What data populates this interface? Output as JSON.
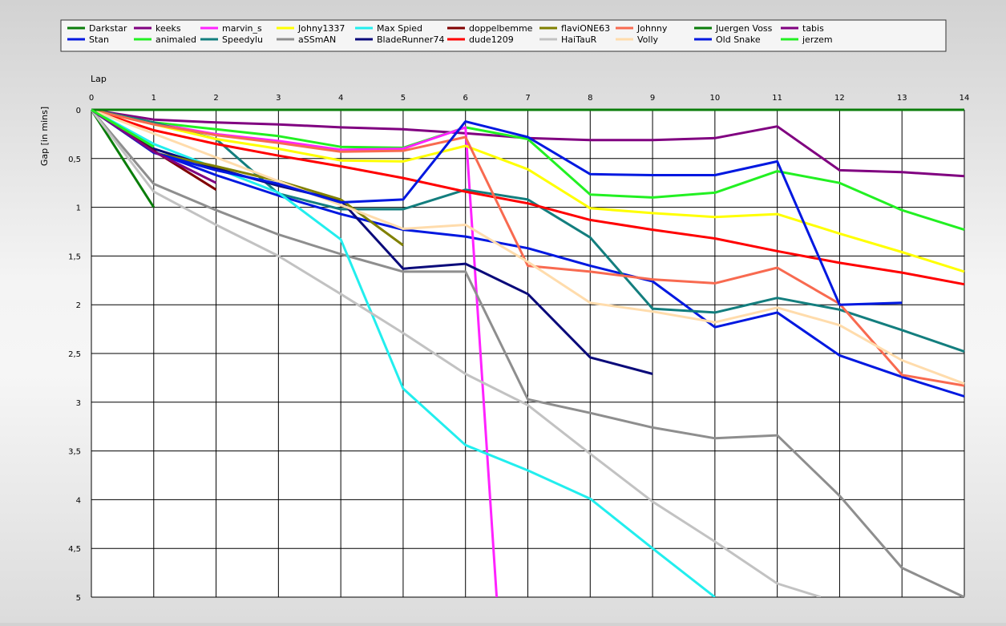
{
  "chart_data": {
    "type": "line",
    "xlabel": "Lap",
    "ylabel": "Gap [in mins]",
    "x_ticks": [
      0,
      1,
      2,
      3,
      4,
      5,
      6,
      7,
      8,
      9,
      10,
      11,
      12,
      13,
      14
    ],
    "y_ticks": [
      "0",
      "0,5",
      "1",
      "1,5",
      "2",
      "2,5",
      "3",
      "3,5",
      "4",
      "4,5",
      "5"
    ],
    "xlim": [
      0,
      14
    ],
    "ylim": [
      0,
      5
    ],
    "y_inverted": true,
    "grid": true,
    "legend_position": "top",
    "series": [
      {
        "name": "Darkstar",
        "color": "#0a7d0a",
        "values": [
          [
            0,
            0
          ],
          [
            1,
            1.0
          ]
        ]
      },
      {
        "name": "Stan",
        "color": "#0018e0",
        "values": [
          [
            0,
            0
          ],
          [
            1,
            0.43
          ],
          [
            2,
            0.67
          ],
          [
            3,
            0.88
          ],
          [
            4,
            1.07
          ],
          [
            5,
            1.23
          ],
          [
            6,
            1.3
          ],
          [
            7,
            1.42
          ],
          [
            8,
            1.6
          ],
          [
            9,
            1.76
          ],
          [
            10,
            2.23
          ],
          [
            11,
            2.08
          ],
          [
            12,
            2.52
          ],
          [
            13,
            2.74
          ],
          [
            14,
            2.94
          ]
        ]
      },
      {
        "name": "keeks",
        "color": "#800080",
        "values": [
          [
            0,
            0
          ],
          [
            1,
            0.1
          ],
          [
            2,
            0.13
          ],
          [
            3,
            0.15
          ],
          [
            4,
            0.18
          ],
          [
            5,
            0.2
          ],
          [
            6,
            0.24
          ],
          [
            7,
            0.29
          ],
          [
            8,
            0.31
          ],
          [
            9,
            0.31
          ],
          [
            10,
            0.29
          ],
          [
            11,
            0.17
          ],
          [
            12,
            0.62
          ],
          [
            13,
            0.64
          ],
          [
            14,
            0.68
          ]
        ]
      },
      {
        "name": "animaled",
        "color": "#22f022",
        "values": [
          [
            0,
            0
          ],
          [
            1,
            0.13
          ],
          [
            2,
            0.2
          ],
          [
            3,
            0.27
          ],
          [
            4,
            0.38
          ],
          [
            5,
            0.39
          ],
          [
            6,
            0.18
          ],
          [
            7,
            0.3
          ],
          [
            8,
            0.87
          ],
          [
            9,
            0.9
          ],
          [
            10,
            0.85
          ],
          [
            11,
            0.63
          ],
          [
            12,
            0.75
          ],
          [
            13,
            1.03
          ],
          [
            14,
            1.23
          ]
        ]
      },
      {
        "name": "marvin_s",
        "color": "#ff22ff",
        "values": [
          [
            0,
            0
          ],
          [
            1,
            0.14
          ],
          [
            2,
            0.25
          ],
          [
            3,
            0.32
          ],
          [
            4,
            0.41
          ],
          [
            5,
            0.4
          ],
          [
            6,
            0.18
          ],
          [
            6.5,
            5.0
          ]
        ]
      },
      {
        "name": "Speedylu",
        "color": "#137e7e",
        "values": [
          [
            0,
            0
          ],
          [
            1,
            0.13
          ],
          [
            2,
            0.3
          ],
          [
            3,
            0.86
          ],
          [
            4,
            1.02
          ],
          [
            5,
            1.02
          ],
          [
            6,
            0.82
          ],
          [
            7,
            0.92
          ],
          [
            8,
            1.31
          ],
          [
            9,
            2.04
          ],
          [
            10,
            2.08
          ],
          [
            11,
            1.93
          ],
          [
            12,
            2.05
          ],
          [
            13,
            2.26
          ],
          [
            14,
            2.48
          ]
        ]
      },
      {
        "name": "Johny1337",
        "color": "#ffff00",
        "values": [
          [
            0,
            0
          ],
          [
            1,
            0.15
          ],
          [
            2,
            0.3
          ],
          [
            3,
            0.4
          ],
          [
            4,
            0.52
          ],
          [
            5,
            0.53
          ],
          [
            6,
            0.37
          ],
          [
            7,
            0.61
          ],
          [
            8,
            1.01
          ],
          [
            9,
            1.06
          ],
          [
            10,
            1.1
          ],
          [
            11,
            1.07
          ],
          [
            12,
            1.27
          ],
          [
            13,
            1.46
          ],
          [
            14,
            1.66
          ]
        ]
      },
      {
        "name": "aSSmAN",
        "color": "#8e8e8e",
        "values": [
          [
            0,
            0
          ],
          [
            1,
            0.76
          ],
          [
            2,
            1.03
          ],
          [
            3,
            1.28
          ],
          [
            4,
            1.48
          ],
          [
            5,
            1.66
          ],
          [
            6,
            1.66
          ],
          [
            7,
            2.97
          ],
          [
            8,
            3.11
          ],
          [
            9,
            3.26
          ],
          [
            10,
            3.37
          ],
          [
            11,
            3.34
          ],
          [
            12,
            3.96
          ],
          [
            13,
            4.7
          ],
          [
            14,
            5.0
          ]
        ]
      },
      {
        "name": "Max Spied",
        "color": "#22eeee",
        "values": [
          [
            0,
            0
          ],
          [
            1,
            0.35
          ],
          [
            2,
            0.6
          ],
          [
            3,
            0.85
          ],
          [
            4,
            1.33
          ],
          [
            5,
            2.86
          ],
          [
            6,
            3.44
          ],
          [
            7,
            3.7
          ],
          [
            8,
            3.99
          ],
          [
            9,
            4.5
          ],
          [
            10,
            5.0
          ]
        ]
      },
      {
        "name": "BladeRunner74",
        "color": "#0a0a7a",
        "values": [
          [
            0,
            0
          ],
          [
            1,
            0.4
          ],
          [
            2,
            0.6
          ],
          [
            3,
            0.78
          ],
          [
            4,
            0.93
          ],
          [
            5,
            1.63
          ],
          [
            6,
            1.58
          ],
          [
            7,
            1.89
          ],
          [
            8,
            2.54
          ],
          [
            9,
            2.71
          ]
        ]
      },
      {
        "name": "doppelbemme",
        "color": "#800000",
        "values": [
          [
            0,
            0
          ],
          [
            1,
            0.42
          ],
          [
            2,
            0.82
          ]
        ]
      },
      {
        "name": "dude1209",
        "color": "#ff0000",
        "values": [
          [
            0,
            0
          ],
          [
            1,
            0.21
          ],
          [
            2,
            0.35
          ],
          [
            3,
            0.47
          ],
          [
            4,
            0.58
          ],
          [
            5,
            0.7
          ],
          [
            6,
            0.84
          ],
          [
            7,
            0.96
          ],
          [
            8,
            1.13
          ],
          [
            9,
            1.23
          ],
          [
            10,
            1.32
          ],
          [
            11,
            1.45
          ],
          [
            12,
            1.57
          ],
          [
            13,
            1.67
          ],
          [
            14,
            1.79
          ]
        ]
      },
      {
        "name": "flaviONE63",
        "color": "#808000",
        "values": [
          [
            0,
            0
          ],
          [
            1,
            0.44
          ],
          [
            2,
            0.58
          ],
          [
            3,
            0.73
          ],
          [
            4,
            0.92
          ],
          [
            5,
            1.39
          ]
        ]
      },
      {
        "name": "HaiTauR",
        "color": "#c2c2c2",
        "values": [
          [
            0,
            0
          ],
          [
            1,
            0.84
          ],
          [
            2,
            1.18
          ],
          [
            3,
            1.5
          ],
          [
            4,
            1.89
          ],
          [
            5,
            2.29
          ],
          [
            6,
            2.71
          ],
          [
            7,
            3.03
          ],
          [
            8,
            3.53
          ],
          [
            9,
            4.02
          ],
          [
            10,
            4.43
          ],
          [
            11,
            4.86
          ],
          [
            11.7,
            5.0
          ]
        ]
      },
      {
        "name": "Johnny",
        "color": "#f86a50",
        "values": [
          [
            0,
            0
          ],
          [
            1,
            0.15
          ],
          [
            2,
            0.26
          ],
          [
            3,
            0.34
          ],
          [
            4,
            0.43
          ],
          [
            5,
            0.42
          ],
          [
            6,
            0.28
          ],
          [
            7,
            1.6
          ],
          [
            8,
            1.66
          ],
          [
            9,
            1.74
          ],
          [
            10,
            1.78
          ],
          [
            11,
            1.62
          ],
          [
            12,
            1.99
          ],
          [
            13,
            2.72
          ],
          [
            14,
            2.83
          ]
        ]
      },
      {
        "name": "Volly",
        "color": "#ffdcac",
        "values": [
          [
            0,
            0
          ],
          [
            5,
            1.22
          ],
          [
            6,
            1.18
          ],
          [
            7,
            1.56
          ],
          [
            8,
            1.98
          ],
          [
            9,
            2.07
          ],
          [
            10,
            2.18
          ],
          [
            11,
            2.03
          ],
          [
            12,
            2.21
          ],
          [
            13,
            2.57
          ],
          [
            14,
            2.81
          ]
        ]
      },
      {
        "name": "Juergen Voss",
        "color": "#0a7d0a",
        "values": [
          [
            0,
            0
          ],
          [
            14,
            0
          ]
        ]
      },
      {
        "name": "Old Snake",
        "color": "#0018e0",
        "values": [
          [
            0,
            0
          ],
          [
            1,
            0.44
          ],
          [
            2,
            0.62
          ],
          [
            3,
            0.76
          ],
          [
            4,
            0.95
          ],
          [
            5,
            0.92
          ],
          [
            6,
            0.12
          ],
          [
            7,
            0.28
          ],
          [
            8,
            0.66
          ],
          [
            9,
            0.67
          ],
          [
            10,
            0.67
          ],
          [
            11,
            0.53
          ],
          [
            12,
            2.0
          ],
          [
            13,
            1.98
          ]
        ]
      },
      {
        "name": "tabis",
        "color": "#800080",
        "values": [
          [
            0,
            0
          ],
          [
            1,
            0.43
          ],
          [
            2,
            0.75
          ]
        ]
      },
      {
        "name": "jerzem",
        "color": "#22f022",
        "values": [
          [
            0,
            0
          ],
          [
            1,
            0.38
          ]
        ]
      }
    ]
  }
}
